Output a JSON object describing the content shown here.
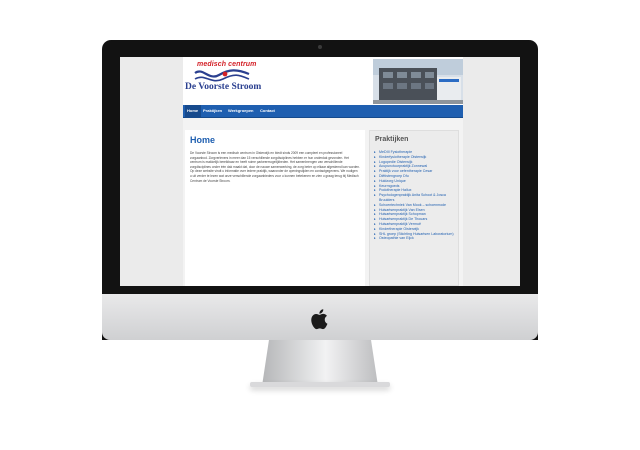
{
  "site": {
    "logo_top": "medisch centrum",
    "logo_main": "De Voorste Stroom"
  },
  "nav": {
    "items": [
      "Home",
      "Praktijken",
      "Werkgroepen",
      "Contact"
    ]
  },
  "content": {
    "title": "Home",
    "intro": "De Voorste Stroom is een medisch centrum in Oisterwijk en biedt sinds 2009 een compleet en professioneel zorgaanbod. Zorgverleners in meer dan 15 verschillende zorgdisciplines hebben er hun onderdak gevonden. Het centrum is makkelijk bereikbaar en heeft ruime parkeermogelijkheden. Het samenbrengen van verschillende zorgdisciplines onder één dak maakt dat, door de nauwe samenwerking, de zorg beter op elkaar afgestemd kan worden. Op deze website vindt u informatie over iedere praktijk, waaronder de openingstijden en contactgegevens. We nodigen u uit verder te lezen wat onze verschillende zorgaanbieders voor u kunnen betekenen en zien u graag terug bij Medisch Centrum de Voorste Stroom."
  },
  "sidebar": {
    "title": "Praktijken",
    "items": [
      "MeDIII Fysiotherapie",
      "Kinderfysiotherapie Oisterwijk",
      "Logopedie Oisterwijk",
      "Acupunctuurpraktijk Zonnewal",
      "Praktijk voor oefentherapie Cesar",
      "Diëtistengroep Dfu",
      "Huidzorg Unique",
      "Keurmgoeds",
      "Podotherapie Hallux",
      "Psychologenpraktijk Anita Schoot & Josca Bruulders",
      "Schoentechniek Van Mook – schoenmode",
      "Huisartsenpraktijk Van Elsen",
      "Huisartsenpraktijk Schopman",
      "Huisartsenpraktijk De Thouars",
      "Huisartsenpraktijk Vermuë",
      "Kindertherapie Oisterwijk",
      "SHL groep (Stichting Huisartsen Laboratorium)",
      "Osteopathie van Eijck"
    ]
  },
  "colors": {
    "brand_blue": "#1f5fb0",
    "logo_red": "#d32027",
    "logo_navy": "#2a3f8f"
  },
  "icons": {
    "device_logo": "apple-logo-icon",
    "list_bullet": "triangle-bullet-icon"
  }
}
